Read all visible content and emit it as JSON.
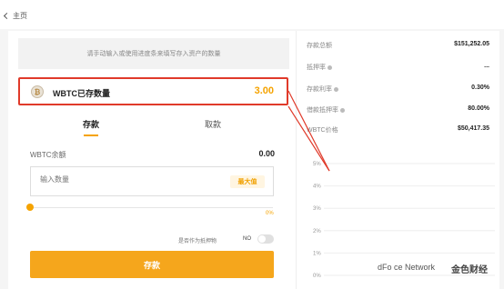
{
  "nav": {
    "back_label": "主页"
  },
  "hint": "请手动输入或使用进度条来填写存入资产的数量",
  "asset": {
    "coin_symbol": "₿",
    "label": "WBTC已存数量",
    "value": "3.00"
  },
  "tabs": [
    {
      "label": "存款",
      "active": true
    },
    {
      "label": "取款",
      "active": false
    }
  ],
  "balance": {
    "label": "WBTC余额",
    "value": "0.00"
  },
  "input": {
    "placeholder": "输入数量",
    "max_label": "最大值"
  },
  "slider": {
    "percent_label": "0%",
    "value": 0
  },
  "collateral": {
    "label": "是否作为抵押物",
    "state": "NO"
  },
  "submit_label": "存款",
  "stats": [
    {
      "label": "存款总额",
      "value": "$151,252.05",
      "info": false
    },
    {
      "label": "抵押率",
      "value": "...",
      "info": true
    },
    {
      "label": "存款利率",
      "value": "0.30%",
      "info": true
    },
    {
      "label": "借款抵押率",
      "value": "80.00%",
      "info": true
    },
    {
      "label": "WBTC价格",
      "value": "$50,417.35",
      "info": false
    }
  ],
  "chart_data": {
    "type": "line",
    "y_ticks": [
      "5%",
      "4%",
      "3%",
      "2%",
      "1%",
      "0%"
    ],
    "ylim": [
      0,
      5
    ],
    "series": []
  },
  "watermark": {
    "text": "dFo",
    "text2": "ce Network",
    "logo": "金色财经"
  },
  "colors": {
    "accent": "#f5a300",
    "highlight_border": "#e03a2a"
  }
}
